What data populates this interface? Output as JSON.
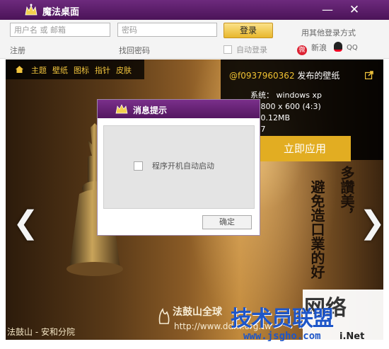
{
  "window": {
    "title": "魔法桌面",
    "min_symbol": "—",
    "close_symbol": "✕"
  },
  "login": {
    "username_placeholder": "用户名 或 邮箱",
    "password_placeholder": "密码",
    "login_label": "登录",
    "register_label": "注册",
    "forgot_label": "找回密码",
    "autologin_label": "自动登录",
    "other_label": "用其他登录方式",
    "weibo_label": "新浪",
    "qq_label": "QQ"
  },
  "nav": {
    "items": [
      "主题",
      "壁纸",
      "图标",
      "指针",
      "皮肤"
    ]
  },
  "wallpaper_info": {
    "uploader": "@f0937960362",
    "uploader_suffix": "发布的壁纸",
    "specs": [
      "系统：  windows xp",
      "：   800 x 600 (4:3)",
      "：   0.12MB",
      "：   7"
    ],
    "apply_label": "立即应用"
  },
  "wallpaper_text": {
    "vertical_1": "多讚美，",
    "vertical_2": "避免造口業的好",
    "org_footer": "法鼓山 - 安和分院",
    "dharma_name": "法鼓山全球",
    "dharma_url": "http://www.ddm.org.tw",
    "left_arrow": "❮",
    "right_arrow": "❯"
  },
  "watermark": {
    "cn_text": "技术员联盟",
    "url": "www.jsgho.com",
    "cn_text2": "网络",
    "net": "i.Net"
  },
  "dialog": {
    "title": "消息提示",
    "checkbox_label": "程序开机自动启动",
    "ok_label": "确定"
  },
  "colors": {
    "accent_purple": "#5c1d6c",
    "button_gold": "#e2ad22",
    "nav_text": "#f2c53d"
  }
}
